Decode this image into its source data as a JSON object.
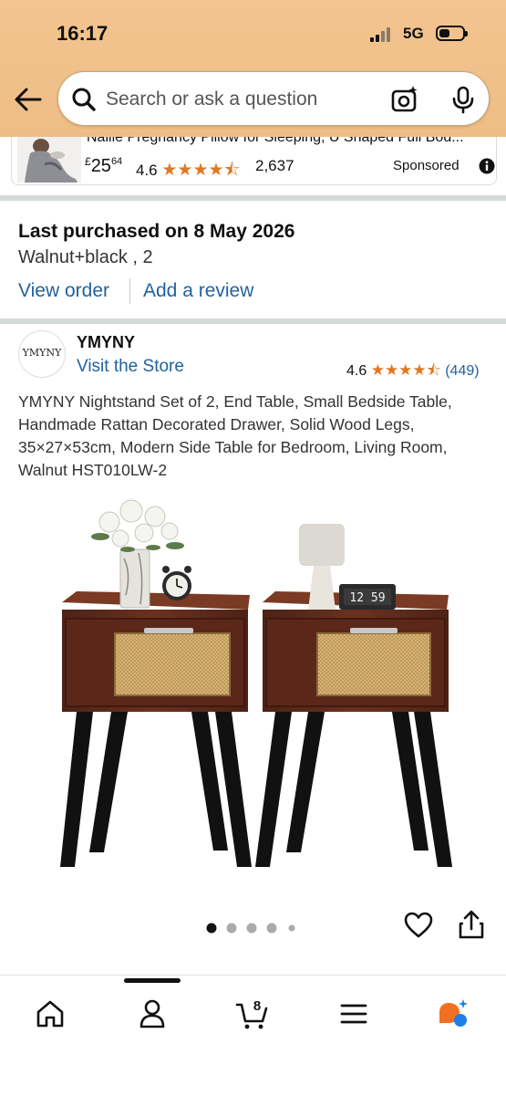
{
  "status_bar": {
    "time": "16:17",
    "network": "5G"
  },
  "search": {
    "placeholder": "Search or ask a question"
  },
  "sponsored_item": {
    "title": "Nalile Pregnancy Pillow for Sleeping, U Shaped Full Bod...",
    "price_currency": "£",
    "price_whole": "25",
    "price_fraction": "64",
    "rating": "4.6",
    "stars": "★★★★⯪",
    "review_count": "2,637",
    "label": "Sponsored"
  },
  "last_purchase": {
    "title": "Last purchased on 8 May 2026",
    "variant": "Walnut+black , 2",
    "view_order_label": "View order",
    "add_review_label": "Add a review"
  },
  "product": {
    "brand_logo_text": "YMYNY",
    "brand": "YMYNY",
    "store_link": "Visit the Store",
    "rating": "4.6",
    "stars": "★★★★⯪",
    "review_count": "(449)",
    "title": "YMYNY Nightstand Set of 2, End Table, Small Bedside Table, Handmade Rattan Decorated Drawer, Solid Wood Legs, 35×27×53cm, Modern Side Table for Bedroom, Living Room, Walnut HST010LW-2",
    "clock_display": "12 59",
    "image_count": 5,
    "active_image": 1
  },
  "bottom_nav": {
    "cart_count": "8"
  },
  "colors": {
    "header_bg": "#f0c08a",
    "link": "#2162a1",
    "star": "#de7921",
    "wood": "#5c2a1c",
    "legs": "#111111",
    "rattan": "#d9b77a",
    "rufus_orange": "#f37021",
    "rufus_blue": "#1e7fe8"
  },
  "icons": [
    "back-arrow-icon",
    "search-icon",
    "camera-icon",
    "mic-icon",
    "info-icon",
    "heart-icon",
    "share-icon",
    "home-icon",
    "account-icon",
    "cart-icon",
    "menu-icon",
    "rufus-icon"
  ]
}
